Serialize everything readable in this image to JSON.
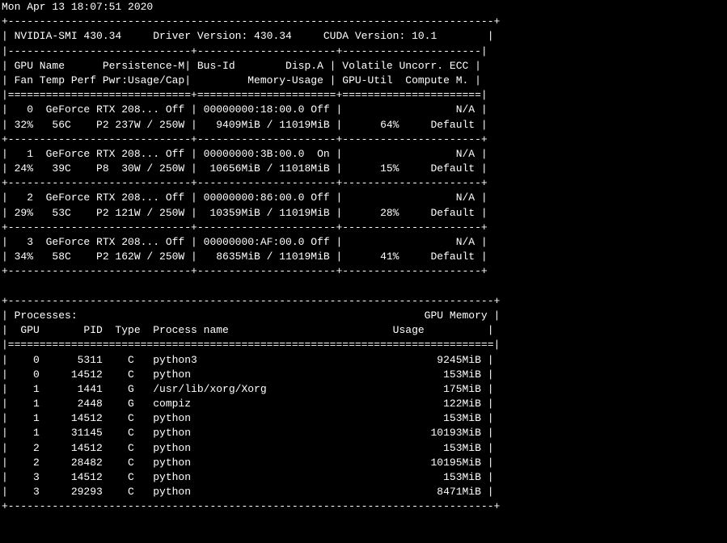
{
  "timestamp": "Mon Apr 13 18:07:51 2020",
  "header": {
    "smi": "NVIDIA-SMI 430.34",
    "driver": "Driver Version: 430.34",
    "cuda": "CUDA Version: 10.1"
  },
  "col_headers": {
    "row1": {
      "gpu": "GPU",
      "name": "Name",
      "persist": "Persistence-M",
      "bus": "Bus-Id",
      "disp": "Disp.A",
      "vol": "Volatile Uncorr. ECC"
    },
    "row2": {
      "fan": "Fan",
      "temp": "Temp",
      "perf": "Perf",
      "pwr": "Pwr:Usage/Cap",
      "mem": "Memory-Usage",
      "util": "GPU-Util",
      "compute": "Compute M."
    }
  },
  "gpus": [
    {
      "idx": "0",
      "name": "GeForce RTX 208...",
      "persist": "Off",
      "bus": "00000000:18:00.0",
      "disp": "Off",
      "ecc": "N/A",
      "fan": "32%",
      "temp": "56C",
      "perf": "P2",
      "pwr": "237W / 250W",
      "mem": "9409MiB / 11019MiB",
      "util": "64%",
      "compute": "Default"
    },
    {
      "idx": "1",
      "name": "GeForce RTX 208...",
      "persist": "Off",
      "bus": "00000000:3B:00.0",
      "disp": "On",
      "ecc": "N/A",
      "fan": "24%",
      "temp": "39C",
      "perf": "P8",
      "pwr": "30W / 250W",
      "mem": "10656MiB / 11018MiB",
      "util": "15%",
      "compute": "Default"
    },
    {
      "idx": "2",
      "name": "GeForce RTX 208...",
      "persist": "Off",
      "bus": "00000000:86:00.0",
      "disp": "Off",
      "ecc": "N/A",
      "fan": "29%",
      "temp": "53C",
      "perf": "P2",
      "pwr": "121W / 250W",
      "mem": "10359MiB / 11019MiB",
      "util": "28%",
      "compute": "Default"
    },
    {
      "idx": "3",
      "name": "GeForce RTX 208...",
      "persist": "Off",
      "bus": "00000000:AF:00.0",
      "disp": "Off",
      "ecc": "N/A",
      "fan": "34%",
      "temp": "58C",
      "perf": "P2",
      "pwr": "162W / 250W",
      "mem": "8635MiB / 11019MiB",
      "util": "41%",
      "compute": "Default"
    }
  ],
  "proc_header": {
    "title": "Processes:",
    "mem_label": "GPU Memory",
    "gpu": "GPU",
    "pid": "PID",
    "type": "Type",
    "pname": "Process name",
    "usage": "Usage"
  },
  "processes": [
    {
      "gpu": "0",
      "pid": "5311",
      "type": "C",
      "name": "python3",
      "mem": "9245MiB"
    },
    {
      "gpu": "0",
      "pid": "14512",
      "type": "C",
      "name": "python",
      "mem": "153MiB"
    },
    {
      "gpu": "1",
      "pid": "1441",
      "type": "G",
      "name": "/usr/lib/xorg/Xorg",
      "mem": "175MiB"
    },
    {
      "gpu": "1",
      "pid": "2448",
      "type": "G",
      "name": "compiz",
      "mem": "122MiB"
    },
    {
      "gpu": "1",
      "pid": "14512",
      "type": "C",
      "name": "python",
      "mem": "153MiB"
    },
    {
      "gpu": "1",
      "pid": "31145",
      "type": "C",
      "name": "python",
      "mem": "10193MiB"
    },
    {
      "gpu": "2",
      "pid": "14512",
      "type": "C",
      "name": "python",
      "mem": "153MiB"
    },
    {
      "gpu": "2",
      "pid": "28482",
      "type": "C",
      "name": "python",
      "mem": "10195MiB"
    },
    {
      "gpu": "3",
      "pid": "14512",
      "type": "C",
      "name": "python",
      "mem": "153MiB"
    },
    {
      "gpu": "3",
      "pid": "29293",
      "type": "C",
      "name": "python",
      "mem": "8471MiB"
    }
  ]
}
